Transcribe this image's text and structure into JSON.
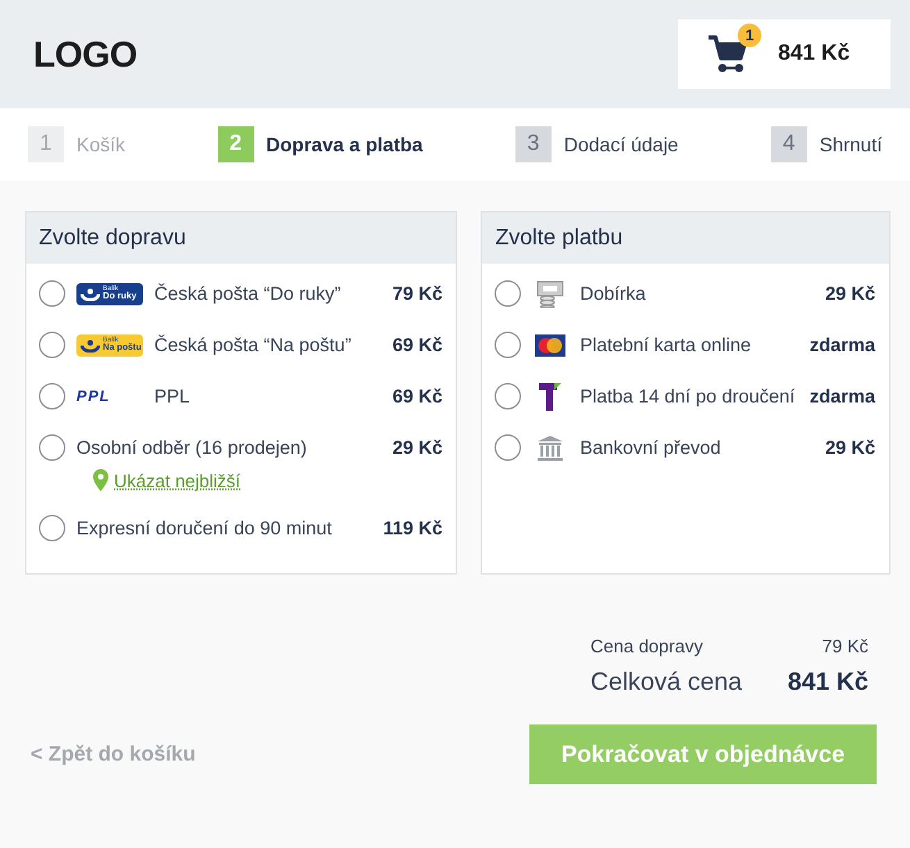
{
  "header": {
    "logo": "LOGO",
    "cart": {
      "count": "1",
      "total": "841 Kč"
    }
  },
  "steps": [
    {
      "number": "1",
      "label": "Košík",
      "selected": false,
      "completed": true
    },
    {
      "number": "2",
      "label": "Doprava a platba",
      "selected": true,
      "completed": false
    },
    {
      "number": "3",
      "label": "Dodací údaje",
      "selected": false,
      "completed": false
    },
    {
      "number": "4",
      "label": "Shrnutí",
      "selected": false,
      "completed": false
    }
  ],
  "shipping": {
    "title": "Zvolte dopravu",
    "options": [
      {
        "logo": {
          "kind": "post-blue",
          "lines": [
            "Balík",
            "Do ruky"
          ]
        },
        "label": "Česká pošta “Do ruky”",
        "price": "79 Kč",
        "selected": false
      },
      {
        "logo": {
          "kind": "post-yellow",
          "lines": [
            "Balík",
            "Na poštu"
          ]
        },
        "label": "Česká pošta “Na poštu”",
        "price": "69 Kč",
        "selected": false
      },
      {
        "logo": {
          "kind": "ppl",
          "lines": [
            "PPL"
          ]
        },
        "label": "PPL",
        "price": "69 Kč",
        "selected": false
      },
      {
        "label": "Osobní odběr (16 prodejen)",
        "price": "29 Kč",
        "selected": false,
        "link": "Ukázat nejbližší"
      },
      {
        "label": "Expresní doručení do 90 minut",
        "price": "119 Kč",
        "selected": false
      }
    ]
  },
  "payment": {
    "title": "Zvolte platbu",
    "options": [
      {
        "kind": "cash",
        "label": "Dobírka",
        "price": "29 Kč",
        "selected": false
      },
      {
        "kind": "card",
        "label": "Platební karta online",
        "price": "zdarma",
        "selected": false
      },
      {
        "kind": "t",
        "label": "Platba 14 dní po droučení",
        "price": "zdarma",
        "selected": false
      },
      {
        "kind": "bank",
        "label": "Bankovní převod",
        "price": "29 Kč",
        "selected": false
      }
    ]
  },
  "summary": {
    "shipping_label": "Cena dopravy",
    "shipping_price": "79 Kč",
    "total_label": "Celková cena",
    "total_price": "841 Kč"
  },
  "back_link": "< Zpět do košíku",
  "continue_button": "Pokračovat v objednávce"
}
